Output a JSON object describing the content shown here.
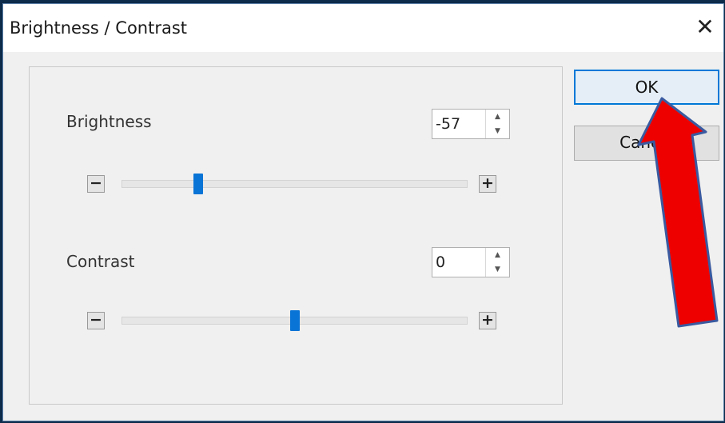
{
  "dialog": {
    "title": "Brightness / Contrast",
    "close_glyph": "✕"
  },
  "brightness": {
    "label": "Brightness",
    "value": "-57",
    "minus": "−",
    "plus": "+",
    "slider_fraction": 0.22
  },
  "contrast": {
    "label": "Contrast",
    "value": "0",
    "minus": "−",
    "plus": "+",
    "slider_fraction": 0.5
  },
  "buttons": {
    "ok": "OK",
    "cancel": "Cancel"
  },
  "annotation": {
    "color": "#ee0000",
    "outline": "#3a5aa0"
  }
}
